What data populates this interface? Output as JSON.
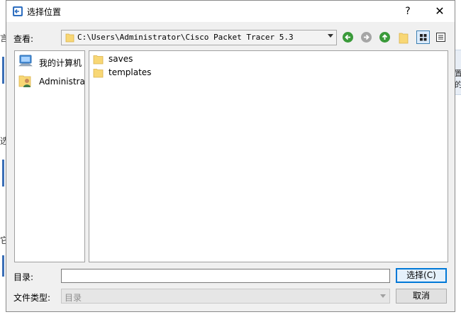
{
  "window": {
    "title": "选择位置",
    "help_glyph": "?",
    "close_glyph": "✕"
  },
  "background": {
    "frag_left_1": "言",
    "frag_left_2": "选",
    "frag_left_3": "它",
    "frag_right_1": "置的"
  },
  "toolbar": {
    "lookin_label": "查看:",
    "path": "C:\\Users\\Administrator\\Cisco Packet Tracer 5.3",
    "icons": [
      "back-icon",
      "forward-icon",
      "up-icon",
      "new-folder-icon",
      "list-view-icon",
      "detail-view-icon"
    ]
  },
  "sidebar": {
    "items": [
      {
        "label": "我的计算机",
        "icon": "computer-icon"
      },
      {
        "label": "Administrator",
        "icon": "user-folder-icon"
      }
    ]
  },
  "files": [
    {
      "name": "saves",
      "icon": "folder-icon"
    },
    {
      "name": "templates",
      "icon": "folder-icon"
    }
  ],
  "form": {
    "directory_label": "目录:",
    "directory_value": "",
    "filetype_label": "文件类型:",
    "filetype_value": "目录"
  },
  "buttons": {
    "choose": "选择(C)",
    "cancel": "取消"
  },
  "colors": {
    "dialog_bg": "#f0f0f0",
    "accent": "#0078d7",
    "folder": "#f8d775",
    "nav_green": "#3a9a3a"
  }
}
